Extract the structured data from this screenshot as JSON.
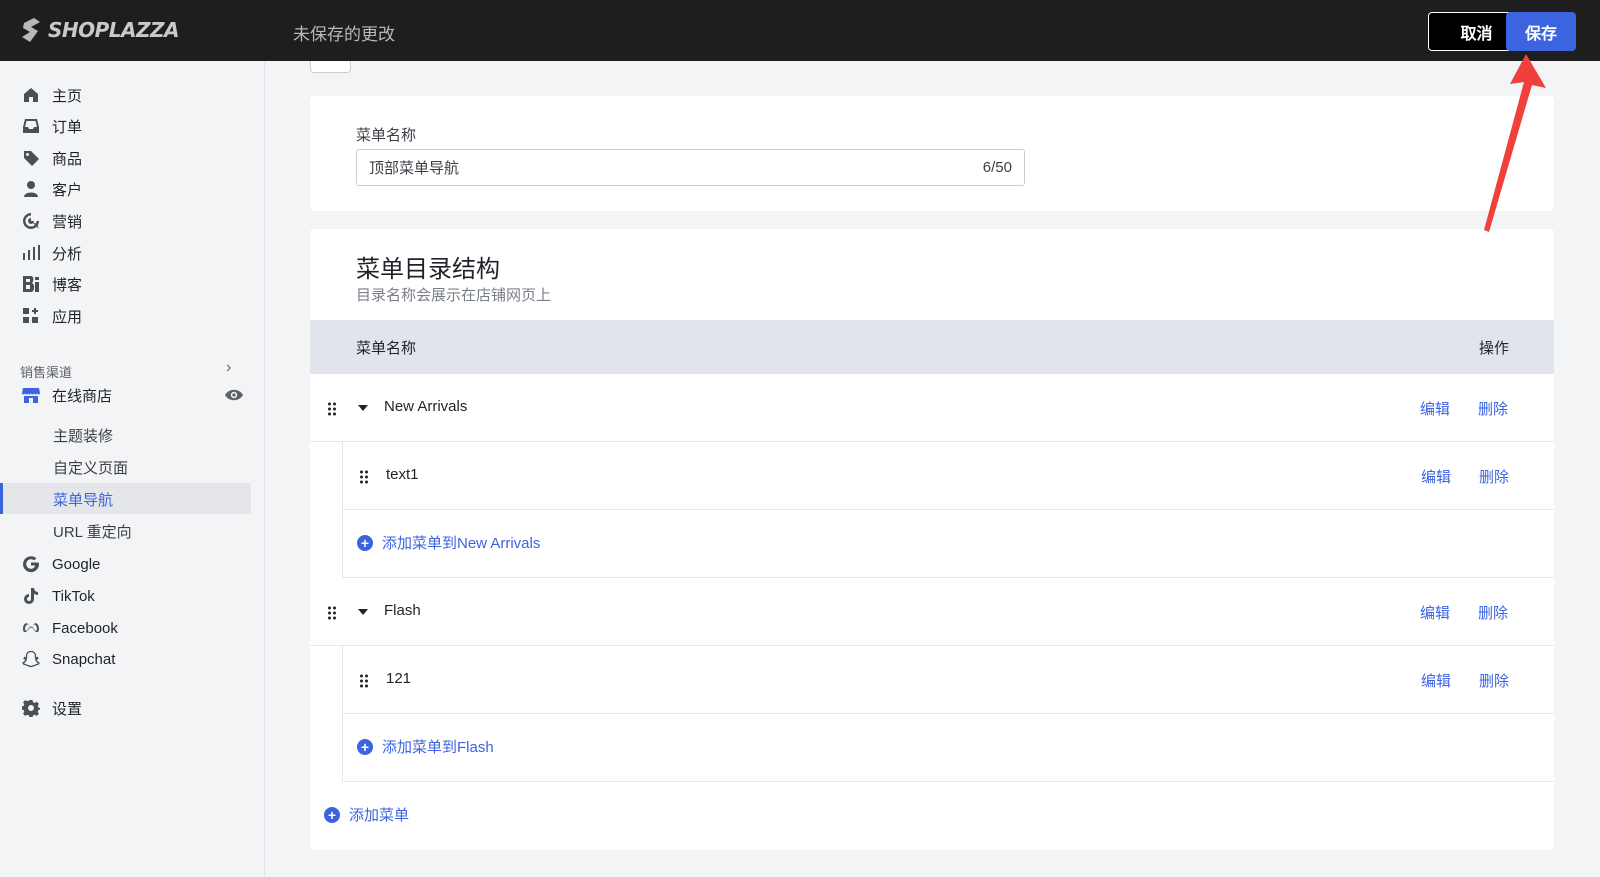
{
  "topbar": {
    "brand": "SHOPLAZZA",
    "unsaved_text": "未保存的更改",
    "cancel_label": "取消",
    "save_label": "保存"
  },
  "sidebar": {
    "items": [
      {
        "label": "主页",
        "icon": "home-icon"
      },
      {
        "label": "订单",
        "icon": "inbox-icon"
      },
      {
        "label": "商品",
        "icon": "tag-icon"
      },
      {
        "label": "客户",
        "icon": "person-icon"
      },
      {
        "label": "营销",
        "icon": "target-icon"
      },
      {
        "label": "分析",
        "icon": "bar-chart-icon"
      },
      {
        "label": "博客",
        "icon": "blog-icon"
      },
      {
        "label": "应用",
        "icon": "apps-icon"
      }
    ],
    "section_label": "销售渠道",
    "online_store": "在线商店",
    "sub_items": [
      "主题装修",
      "自定义页面",
      "菜单导航",
      "URL 重定向"
    ],
    "channels": [
      {
        "label": "Google",
        "icon": "google-icon"
      },
      {
        "label": "TikTok",
        "icon": "tiktok-icon"
      },
      {
        "label": "Facebook",
        "icon": "meta-icon"
      },
      {
        "label": "Snapchat",
        "icon": "snapchat-icon"
      }
    ],
    "settings": "设置"
  },
  "name_card": {
    "label": "菜单名称",
    "value": "顶部菜单导航",
    "counter": "6/50"
  },
  "structure": {
    "title": "菜单目录结构",
    "subtitle": "目录名称会展示在店铺网页上",
    "col_name": "菜单名称",
    "col_action": "操作",
    "edit_label": "编辑",
    "delete_label": "删除",
    "menus": [
      {
        "label": "New Arrivals",
        "children": [
          "text1"
        ],
        "add_label": "添加菜单到New Arrivals"
      },
      {
        "label": "Flash",
        "children": [
          "121"
        ],
        "add_label": "添加菜单到Flash"
      }
    ],
    "add_menu_label": "添加菜单"
  },
  "colors": {
    "accent": "#3c63e0",
    "topbar": "#1e1e1f",
    "annotation_arrow": "#f0403c"
  }
}
